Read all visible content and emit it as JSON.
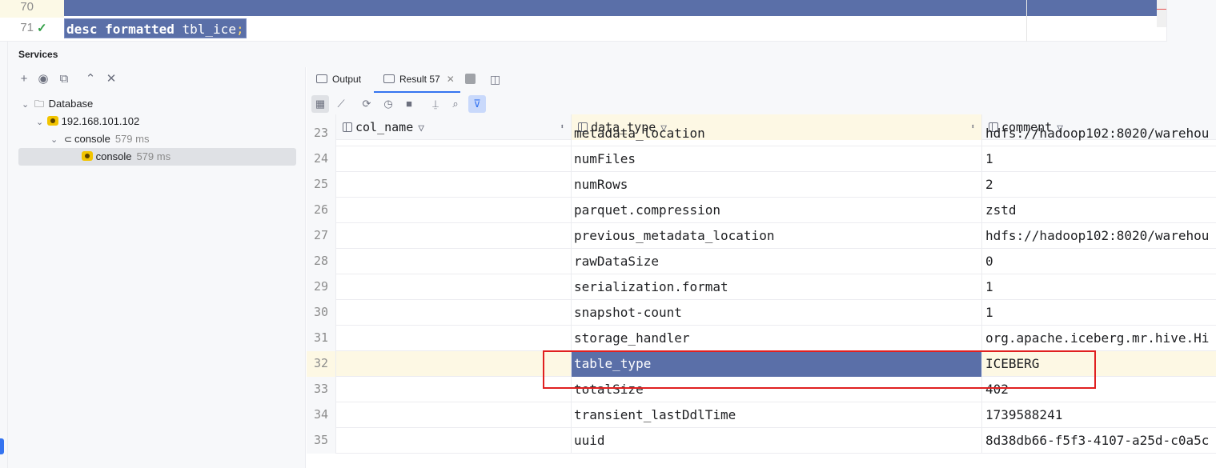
{
  "editor": {
    "lines": [
      {
        "number": "70",
        "code": ""
      },
      {
        "number": "71",
        "keyword1": "desc",
        "keyword2": "formatted",
        "identifier": "tbl_ice",
        "terminator": ";"
      }
    ]
  },
  "services": {
    "title": "Services"
  },
  "tree": {
    "root": "Database",
    "host": "192.168.101.102",
    "console_group": {
      "label": "console",
      "time": "579 ms"
    },
    "console_item": {
      "label": "console",
      "time": "579 ms"
    }
  },
  "tabs": {
    "output": "Output",
    "result": "Result 57"
  },
  "grid": {
    "columns": [
      "col_name",
      "data_type",
      "comment"
    ],
    "partial_top": {
      "number": "23",
      "data_type": "metadata_location",
      "comment": "hdfs://hadoop102:8020/warehou"
    },
    "rows": [
      {
        "number": "24",
        "col_name": "",
        "data_type": "numFiles",
        "comment": "1"
      },
      {
        "number": "25",
        "col_name": "",
        "data_type": "numRows",
        "comment": "2"
      },
      {
        "number": "26",
        "col_name": "",
        "data_type": "parquet.compression",
        "comment": "zstd"
      },
      {
        "number": "27",
        "col_name": "",
        "data_type": "previous_metadata_location",
        "comment": "hdfs://hadoop102:8020/warehou"
      },
      {
        "number": "28",
        "col_name": "",
        "data_type": "rawDataSize",
        "comment": "0"
      },
      {
        "number": "29",
        "col_name": "",
        "data_type": "serialization.format",
        "comment": "1"
      },
      {
        "number": "30",
        "col_name": "",
        "data_type": "snapshot-count",
        "comment": "1"
      },
      {
        "number": "31",
        "col_name": "",
        "data_type": "storage_handler",
        "comment": "org.apache.iceberg.mr.hive.Hi"
      },
      {
        "number": "32",
        "col_name": "",
        "data_type": "table_type",
        "comment": "ICEBERG"
      },
      {
        "number": "33",
        "col_name": "",
        "data_type": "totalSize",
        "comment": "402"
      },
      {
        "number": "34",
        "col_name": "",
        "data_type": "transient_lastDdlTime",
        "comment": "1739588241"
      },
      {
        "number": "35",
        "col_name": "",
        "data_type": "uuid",
        "comment": "8d38db66-f5f3-4107-a25d-c0a5c"
      }
    ],
    "selected_row": "32"
  },
  "colors": {
    "selection": "#5a6fa8",
    "highlight_box": "#e02020",
    "current_row": "#fdf8e4"
  }
}
